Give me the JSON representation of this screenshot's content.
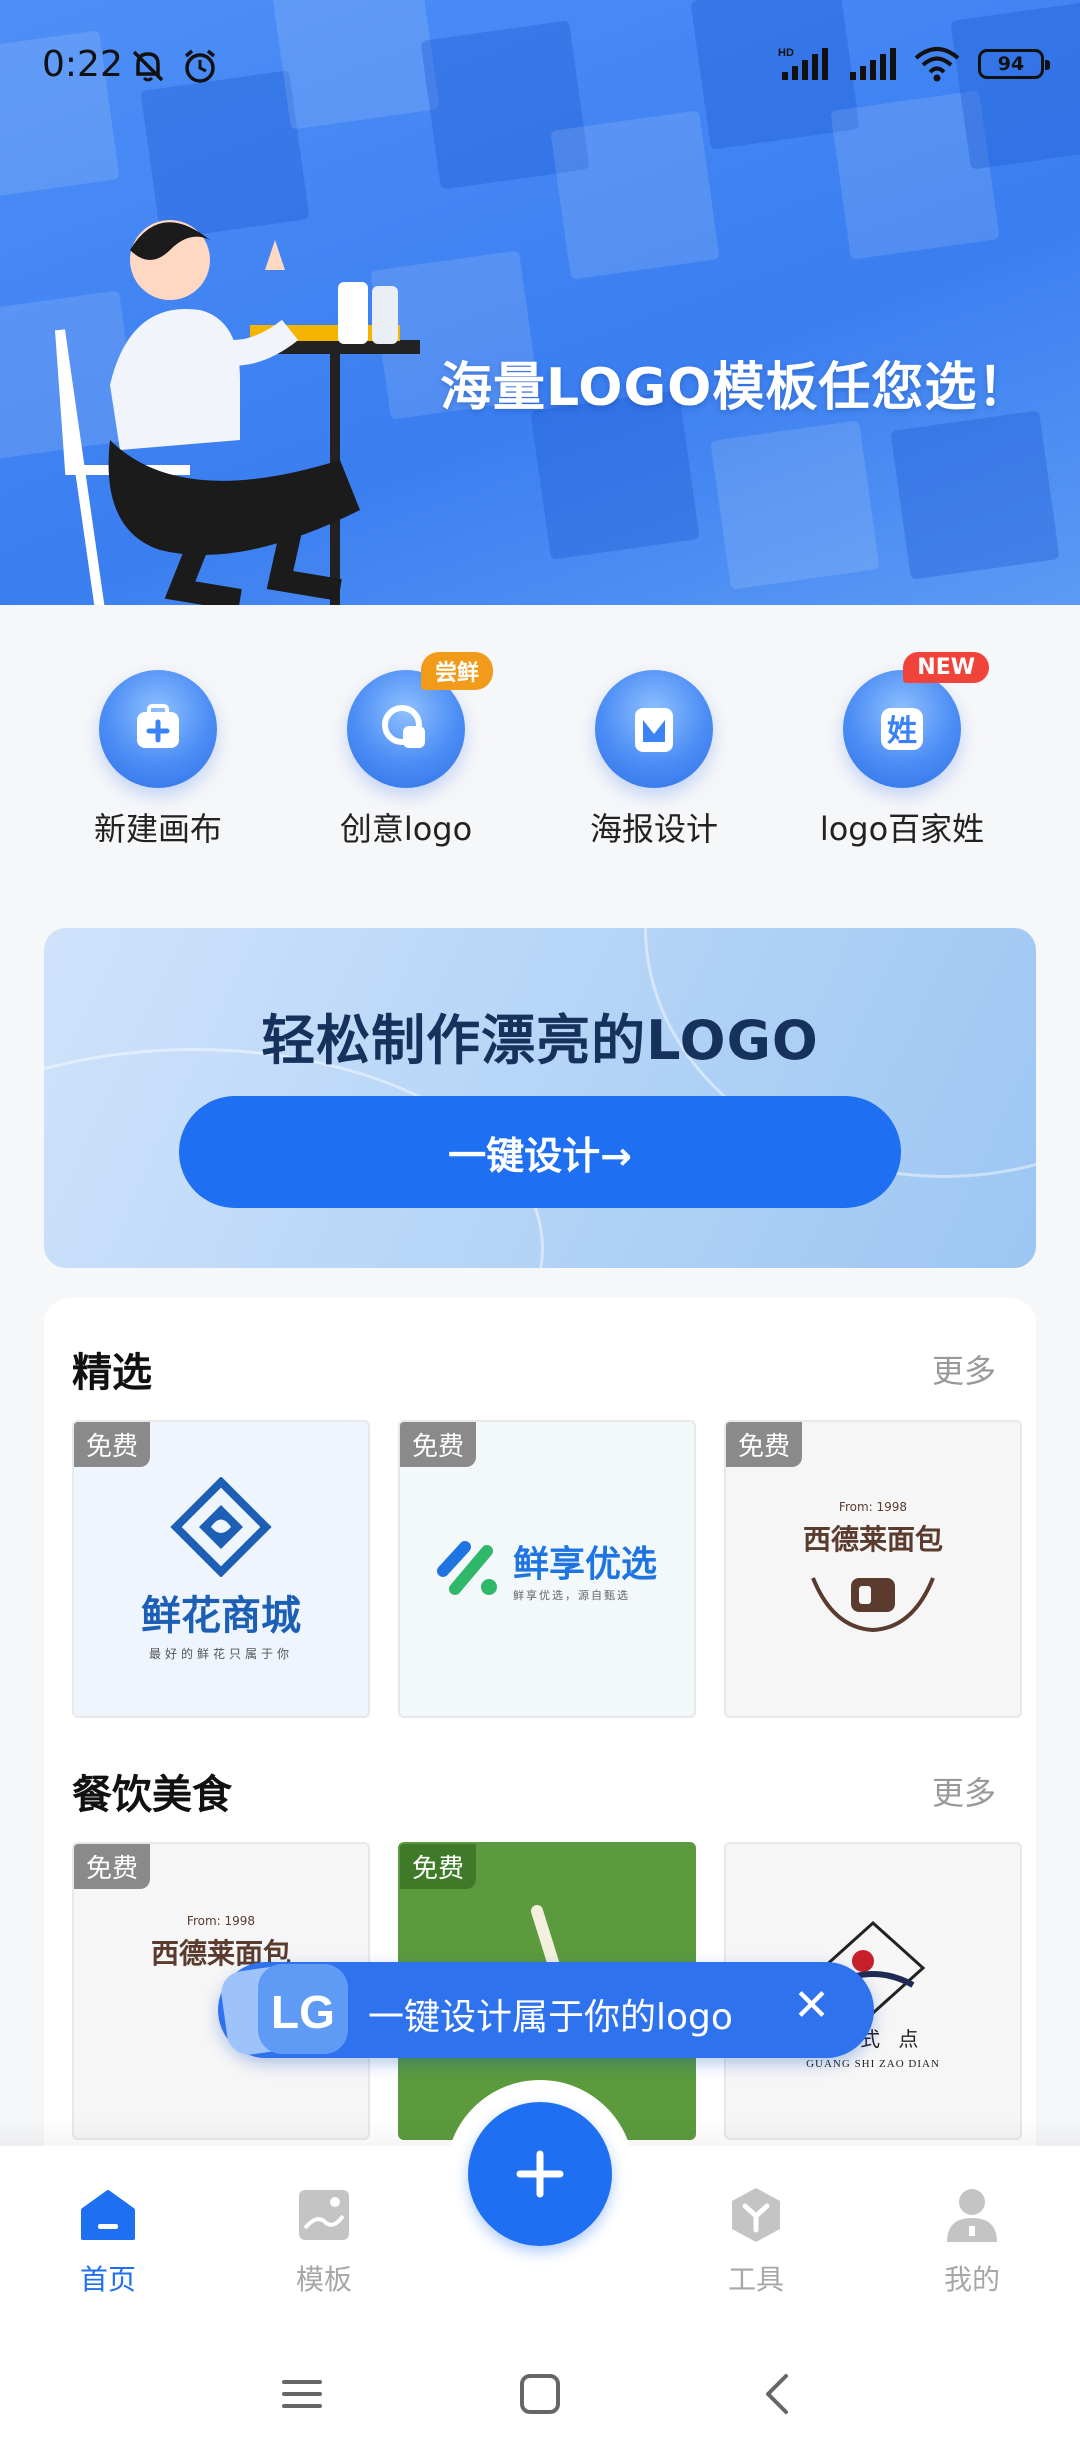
{
  "status_bar": {
    "time": "0:22",
    "battery": "94",
    "network_label": "HD"
  },
  "hero": {
    "title": "海量LOGO模板任您选！"
  },
  "quick_actions": [
    {
      "label": "新建画布",
      "icon": "new-canvas-icon",
      "badge": ""
    },
    {
      "label": "创意logo",
      "icon": "creative-logo-icon",
      "badge": "尝鲜"
    },
    {
      "label": "海报设计",
      "icon": "poster-design-icon",
      "badge": ""
    },
    {
      "label": "logo百家姓",
      "icon": "surname-logo-icon",
      "badge": "NEW"
    }
  ],
  "promo": {
    "title": "轻松制作漂亮的LOGO",
    "button": "一键设计→"
  },
  "sections": [
    {
      "title": "精选",
      "more": "更多",
      "items": [
        {
          "tag": "免费",
          "name": "鲜花商城",
          "sub": "最好的鲜花只属于你"
        },
        {
          "tag": "免费",
          "name": "鲜享优选",
          "sub": "鲜享优选，源自甄选"
        },
        {
          "tag": "免费",
          "name": "西德莱面包",
          "sub": "From: 1998"
        }
      ]
    },
    {
      "title": "餐饮美食",
      "more": "更多",
      "items": [
        {
          "tag": "免费",
          "name": "西德莱面包",
          "sub": "From: 1998"
        },
        {
          "tag": "免费",
          "name": "",
          "sub": ""
        },
        {
          "tag": "",
          "name": "广 式 点",
          "sub": "GUANG SHI ZAO DIAN"
        }
      ]
    }
  ],
  "tip": {
    "text": "一键设计属于你的logo",
    "close": "✕"
  },
  "bottom_nav": [
    {
      "label": "首页",
      "icon": "home-icon",
      "active": true
    },
    {
      "label": "模板",
      "icon": "template-icon",
      "active": false
    },
    {
      "label": "工具",
      "icon": "tools-icon",
      "active": false
    },
    {
      "label": "我的",
      "icon": "profile-icon",
      "active": false
    }
  ],
  "colors": {
    "primary": "#1f6ff2",
    "hero": "#4a8cf6",
    "badge_orange": "#f29a1a",
    "badge_red": "#f0433a"
  }
}
